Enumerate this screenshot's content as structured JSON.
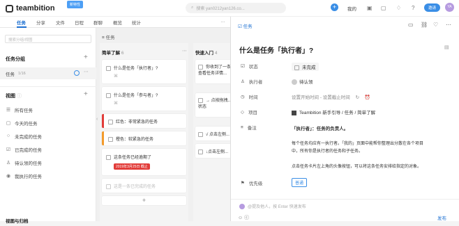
{
  "topbar": {
    "logo": "teambition",
    "badge": "新特性",
    "search_placeholder": "搜索 yan0212yan126.co...",
    "mine": "我的",
    "upgrade": "邀请",
    "avatar": "YA"
  },
  "tabs": [
    "任务",
    "分享",
    "文件",
    "日程",
    "群聊",
    "概览",
    "统计"
  ],
  "sidebar": {
    "search_placeholder": "搜索分组/视图",
    "group_header": "任务分组",
    "group_name": "任务",
    "group_count": "1/16",
    "view_header": "视图",
    "views": [
      "所有任务",
      "今天的任务",
      "未完成的任务",
      "已完成的任务",
      "待认领的任务",
      "我执行的任务"
    ],
    "bottom": "视图与归档"
  },
  "board": {
    "header": "任务",
    "col1": {
      "name": "简单了解",
      "count": "6",
      "cards": [
        "什么是任务「执行者」?",
        "什么是任务「参与者」?",
        "红色：非常紧急的任务",
        "橙色：较紧急的任务",
        "这条任务已经逾期了",
        "这是一条已完成的任务"
      ],
      "due": "2019年3月25日 截止"
    },
    "col2": {
      "name": "快速入门",
      "count": "4",
      "cards": [
        "你收到了一条...\n查看任务详情...",
        "→ 点按拖拽...\n状态",
        "√ 点击左侧...",
        "↓点击左侧..."
      ]
    }
  },
  "panel": {
    "crumb": "任务",
    "title": "什么是任务「执行者」?",
    "status_label": "状态",
    "status_value": "未完成",
    "executor_label": "执行者",
    "executor_value": "待认领",
    "time_label": "时间",
    "time_start": "设置开始时间",
    "time_sep": "-",
    "time_end": "设置截止时间",
    "project_label": "项目",
    "project_path": "Teambition 新手引导  /  任务  /  简单了解",
    "note_label": "备注",
    "note_lines": [
      "「执行者」：任务的负责人。",
      "每个任务均应有一执行者。「我的」页面中能帮你整理出分散在各个项目",
      "中，所有你是执行者的任务和子任务。",
      "点击任务卡片左上角的头像按钮，可以将这条任务安排给指定的对象。"
    ],
    "priority_label": "优先级",
    "priority_value": "普通",
    "comment_placeholder": "@提及他人，按 Enter 快速发布",
    "publish": "发布"
  }
}
